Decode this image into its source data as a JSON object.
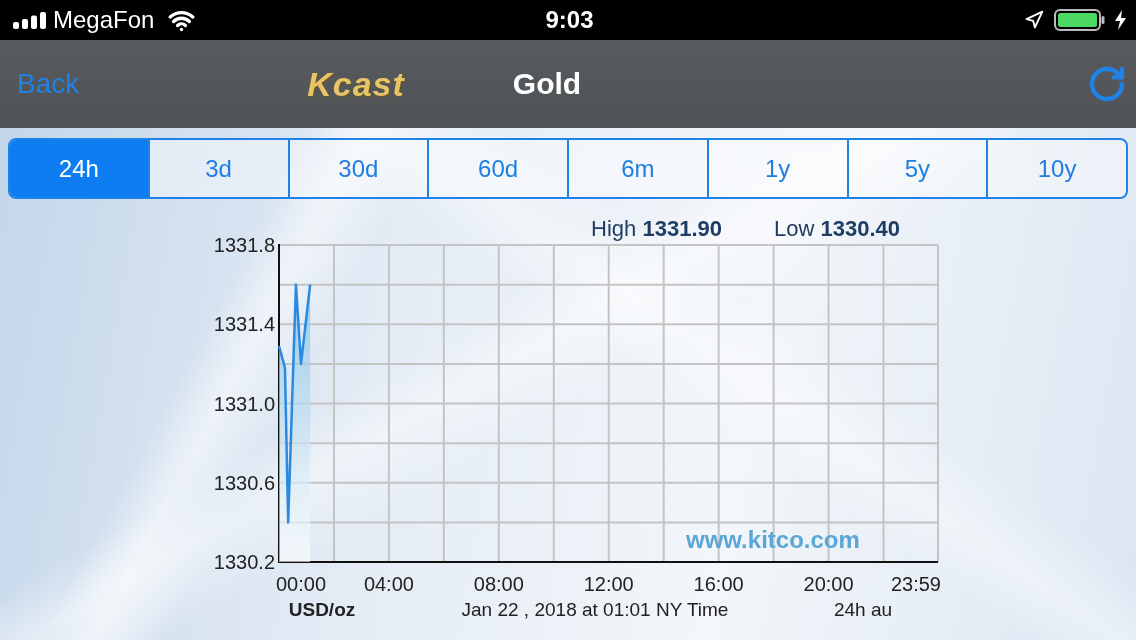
{
  "status_bar": {
    "carrier": "MegaFon",
    "time": "9:03"
  },
  "nav_bar": {
    "back": "Back",
    "logo": "Kcast",
    "title": "Gold"
  },
  "tabs": [
    {
      "label": "24h",
      "selected": true
    },
    {
      "label": "3d",
      "selected": false
    },
    {
      "label": "30d",
      "selected": false
    },
    {
      "label": "60d",
      "selected": false
    },
    {
      "label": "6m",
      "selected": false
    },
    {
      "label": "1y",
      "selected": false
    },
    {
      "label": "5y",
      "selected": false
    },
    {
      "label": "10y",
      "selected": false
    }
  ],
  "chart_panel": {
    "high_label": "High **1331.90**",
    "low_label": "Low **1330.40**",
    "source": "www.kitco.com",
    "unit": "USD/oz",
    "timestamp": "Jan 22 , 2018 at 01:01 NY Time",
    "range_note": "24h au",
    "chart_data": {
      "type": "area",
      "x": [
        0,
        13,
        20,
        37,
        48,
        68
      ],
      "series": [
        {
          "color": "#2a8ae0",
          "values": [
            1331.29,
            1331.18,
            1330.4,
            1331.6,
            1331.2,
            1331.6
          ]
        }
      ],
      "xlim": [
        0,
        1439
      ],
      "ylim": [
        1330.2,
        1331.8
      ],
      "grid": true,
      "xticks": [
        {
          "value": 0,
          "label": "00:00"
        },
        {
          "value": 240,
          "label": "04:00"
        },
        {
          "value": 480,
          "label": "08:00"
        },
        {
          "value": 720,
          "label": "12:00"
        },
        {
          "value": 960,
          "label": "16:00"
        },
        {
          "value": 1200,
          "label": "20:00"
        },
        {
          "value": 1439,
          "label": "23:59"
        }
      ],
      "yticks": [
        {
          "value": 1330.2,
          "label": "1330.2"
        },
        {
          "value": 1330.6,
          "label": "1330.6"
        },
        {
          "value": 1331.0,
          "label": "1331.0"
        },
        {
          "value": 1331.4,
          "label": "1331.4"
        },
        {
          "value": 1331.8,
          "label": "1331.8"
        }
      ]
    }
  }
}
